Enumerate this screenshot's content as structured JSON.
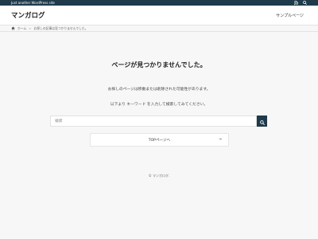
{
  "topbar": {
    "tagline": "Just another WordPress site",
    "icons": [
      "rss-icon",
      "search-icon"
    ]
  },
  "header": {
    "site_title": "マンガログ",
    "nav_items": [
      "サンプルページ"
    ]
  },
  "breadcrumb": {
    "home": "ホーム",
    "separator": ">",
    "current": "お探しの記事は見つかりませんでした。"
  },
  "not_found": {
    "title": "ページが見つかりませんでした。",
    "message1": "お探しのページは移動または削除された可能性があります。",
    "message2": "以下より キーワード を入力して検索してみてください。"
  },
  "search": {
    "placeholder": "検索"
  },
  "top_link": {
    "label": "TOPページへ",
    "arrow": "→"
  },
  "footer": {
    "copyright": "© マンガログ."
  },
  "colors": {
    "accent": "#1f3a4a",
    "background": "#f7f7f7"
  }
}
